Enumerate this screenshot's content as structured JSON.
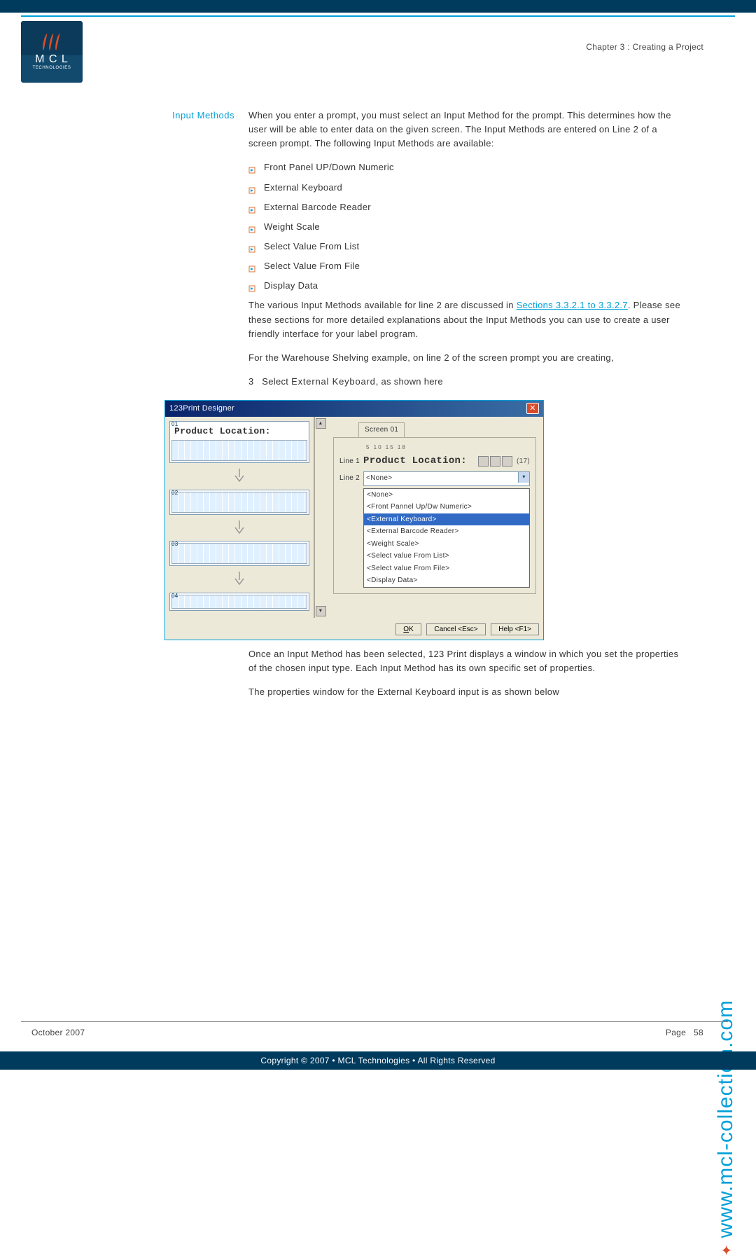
{
  "chapter": "Chapter 3 : Creating a Project",
  "logo": {
    "mcl": "M C L",
    "tech": "TECHNOLOGIES"
  },
  "side_label": "Input Methods",
  "intro": "When you enter a prompt, you must select an Input Method for the prompt. This determines how the user will be able to enter data on the given screen. The Input Methods are entered on Line 2 of a screen prompt. The following Input Methods are available:",
  "methods": [
    "Front Panel UP/Down Numeric",
    "External Keyboard",
    "External Barcode Reader",
    "Weight Scale",
    "Select Value From List",
    "Select Value From File",
    "Display Data"
  ],
  "para2a": "The various Input Methods available for line 2 are discussed in ",
  "para2link": "Sections 3.3.2.1 to 3.3.2.7",
  "para2b": ". Please see these sections for more detailed explanations about the Input Methods you can use to create a user friendly interface for your label program.",
  "para3": "For the Warehouse Shelving example, on line 2 of the screen prompt you are creating,",
  "step_num": "3",
  "step_text_a": "Select ",
  "step_text_b": "External Keyboard",
  "step_text_c": ", as shown here",
  "screenshot": {
    "title": "123Print Designer",
    "tab": "Screen 01",
    "ruler": "5        10        15        18",
    "line1_label": "Line 1",
    "line1_text": "Product Location:",
    "line1_count": "(17)",
    "line2_label": "Line 2",
    "line2_value": "<None>",
    "dropdown": [
      "<None>",
      "<Front Pannel Up/Dw Numeric>",
      "<External Keyboard>",
      "<External Barcode Reader>",
      "<Weight Scale>",
      "<Select value From List>",
      "<Select value From File>",
      "<Display Data>"
    ],
    "selected_index": 2,
    "left_line1": "Product Location:",
    "slots": [
      "01",
      "02",
      "03",
      "04"
    ],
    "ok": "OK",
    "cancel": "Cancel <Esc>",
    "help": "Help <F1>"
  },
  "para4": "Once an Input Method has been selected, 123 Print displays a window in which you set the properties of the chosen input type. Each Input Method has its own specific set of properties.",
  "para5": "The properties window for the External Keyboard input is as shown below",
  "footer_date": "October 2007",
  "footer_page_label": "Page",
  "footer_page_num": "58",
  "copyright": "Copyright © 2007 • MCL Technologies • All Rights Reserved",
  "url": "www.mcl-collection.com"
}
